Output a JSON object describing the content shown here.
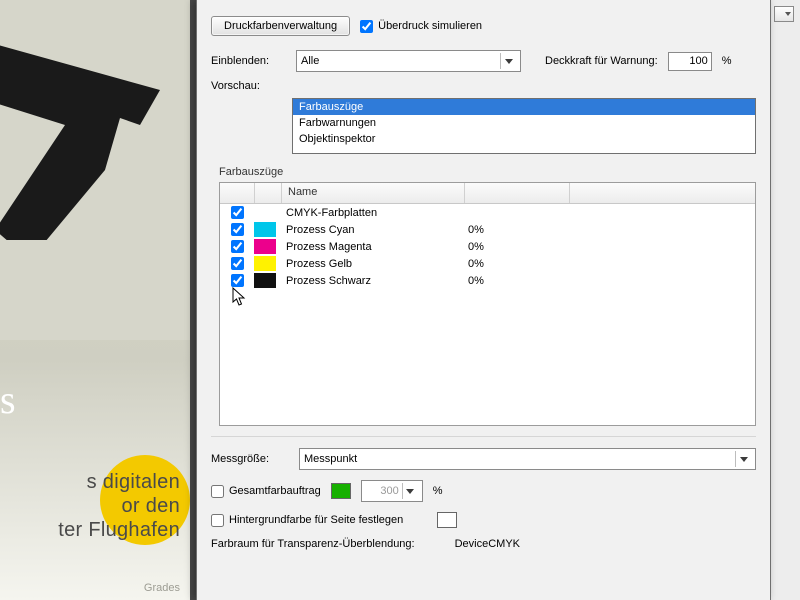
{
  "bg": {
    "whiteS": "s",
    "line1": "s digitalen",
    "line2": "or den",
    "line3": "ter Flughafen",
    "grades": "Grades"
  },
  "buttons": {
    "ink_manager": "Druckfarbenverwaltung"
  },
  "checks": {
    "simulate_overprint": "Überdruck simulieren",
    "total_area": "Gesamtfarbauftrag",
    "set_page_bg": "Hintergrundfarbe für Seite festlegen"
  },
  "labels": {
    "show": "Einblenden:",
    "preview": "Vorschau:",
    "opacity_warning": "Deckkraft für Warnung:",
    "sample_size": "Messgröße:",
    "blend_space": "Farbraum für Transparenz-Überblendung:"
  },
  "show_combo": {
    "value": "Alle"
  },
  "preview_list": [
    "Farbauszüge",
    "Farbwarnungen",
    "Objektinspektor"
  ],
  "opacity": {
    "value": "100",
    "suffix": "%"
  },
  "group": {
    "separations": "Farbauszüge"
  },
  "table": {
    "headers": {
      "name": "Name"
    },
    "rows": [
      {
        "name": "CMYK-Farbplatten",
        "pct": "",
        "color": null,
        "checked": true
      },
      {
        "name": "Prozess Cyan",
        "pct": "0%",
        "color": "#00c6ea",
        "checked": true
      },
      {
        "name": "Prozess Magenta",
        "pct": "0%",
        "color": "#ec008c",
        "checked": true
      },
      {
        "name": "Prozess Gelb",
        "pct": "0%",
        "color": "#fff200",
        "checked": true
      },
      {
        "name": "Prozess Schwarz",
        "pct": "0%",
        "color": "#111111",
        "checked": true
      }
    ]
  },
  "sample_size_combo": {
    "value": "Messpunkt"
  },
  "total_area": {
    "swatch": "#17b000",
    "value": "300",
    "suffix": "%"
  },
  "page_bg": {
    "swatch": "#ffffff"
  },
  "blend_space_value": "DeviceCMYK"
}
